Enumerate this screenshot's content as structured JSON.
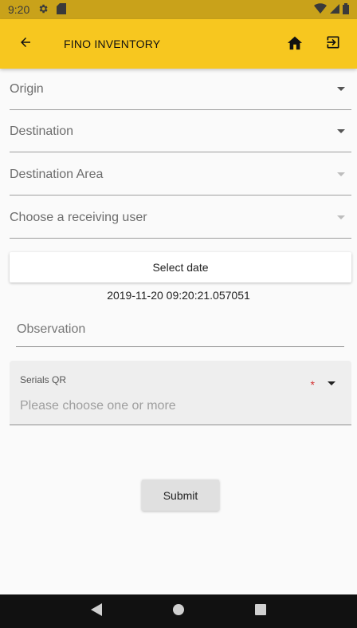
{
  "status_bar": {
    "time": "9:20",
    "icons": [
      "settings-icon",
      "sd-card-icon",
      "wifi-icon",
      "signal-icon",
      "battery-icon"
    ]
  },
  "app_bar": {
    "title": "FINO INVENTORY",
    "background": "#f7c71f",
    "icons": {
      "back": "arrow-back-icon",
      "home": "home-icon",
      "logout": "exit-icon"
    }
  },
  "form": {
    "origin": "Origin",
    "destination": "Destination",
    "destination_area": "Destination Area",
    "receiving_user": "Choose a receiving user",
    "select_date": "Select date",
    "date_value": "2019-11-20 09:20:21.057051",
    "observation_placeholder": "Observation",
    "serials_label": "Serials QR",
    "serials_placeholder": "Please choose one or more",
    "required_mark": "*",
    "submit": "Submit"
  },
  "nav_bar": {
    "icons": [
      "back-triangle-icon",
      "home-circle-icon",
      "recents-square-icon"
    ]
  }
}
